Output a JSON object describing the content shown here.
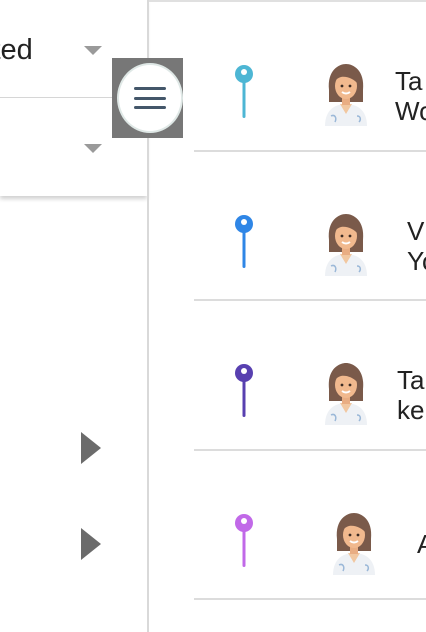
{
  "filter": {
    "select1_value": "ited",
    "select2_value": ""
  },
  "menu": {
    "icon": "hamburger-menu-icon"
  },
  "items": [
    {
      "pin_color": "#4db6d4",
      "line1": "Ta",
      "line2": "Wo",
      "avatar": "doctor-avatar-icon"
    },
    {
      "pin_color": "#2f86e6",
      "line1": "V",
      "line2": "Yo",
      "avatar": "doctor-avatar-icon"
    },
    {
      "pin_color": "#5840b0",
      "line1": "Ta",
      "line2": "ke",
      "avatar": "doctor-avatar-icon"
    },
    {
      "pin_color": "#c169e8",
      "line1": "A",
      "line2": "",
      "avatar": "doctor-avatar-icon"
    }
  ]
}
